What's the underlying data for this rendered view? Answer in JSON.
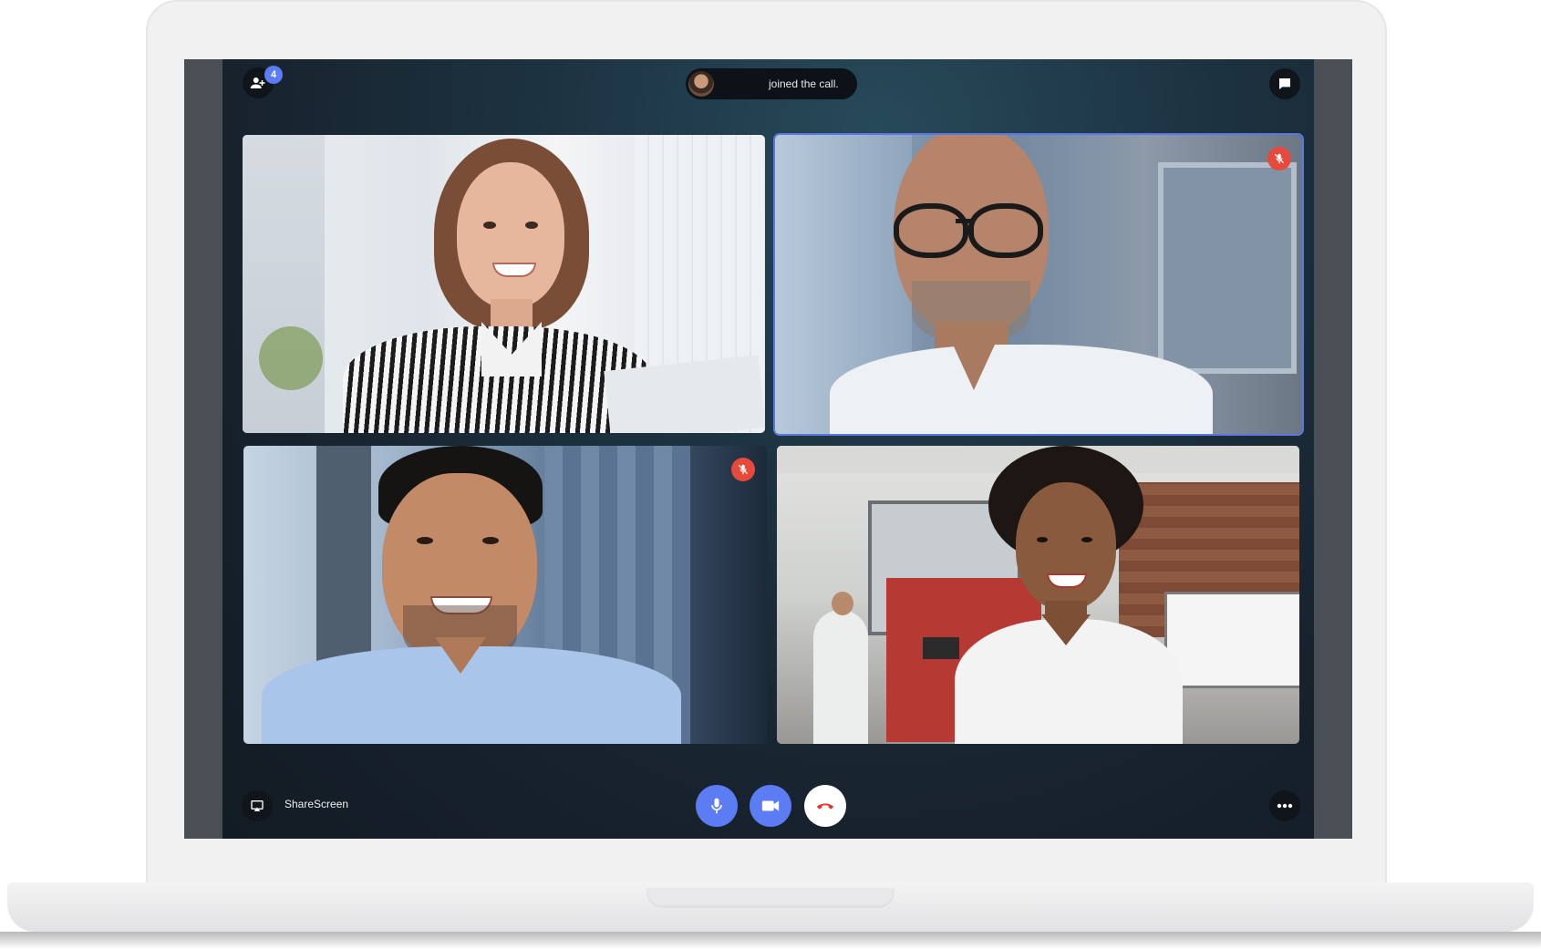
{
  "header": {
    "participants_count": "4",
    "notification_text": "joined the call."
  },
  "participants": [
    {
      "tile": "woman-striped-shirt",
      "muted": false,
      "active": false
    },
    {
      "tile": "man-glasses",
      "muted": true,
      "active": true
    },
    {
      "tile": "man-blue-shirt",
      "muted": true,
      "active": false
    },
    {
      "tile": "woman-white-top",
      "muted": false,
      "active": false
    }
  ],
  "toolbar": {
    "share_screen_label": "ShareScreen",
    "mic_icon": "microphone-icon",
    "camera_icon": "video-camera-icon",
    "end_call_icon": "phone-hangup-icon",
    "more_icon": "more-options-icon"
  },
  "colors": {
    "accent": "#5c7cf4",
    "muted_red": "#e54a3c",
    "end_call_red": "#e5332a"
  }
}
